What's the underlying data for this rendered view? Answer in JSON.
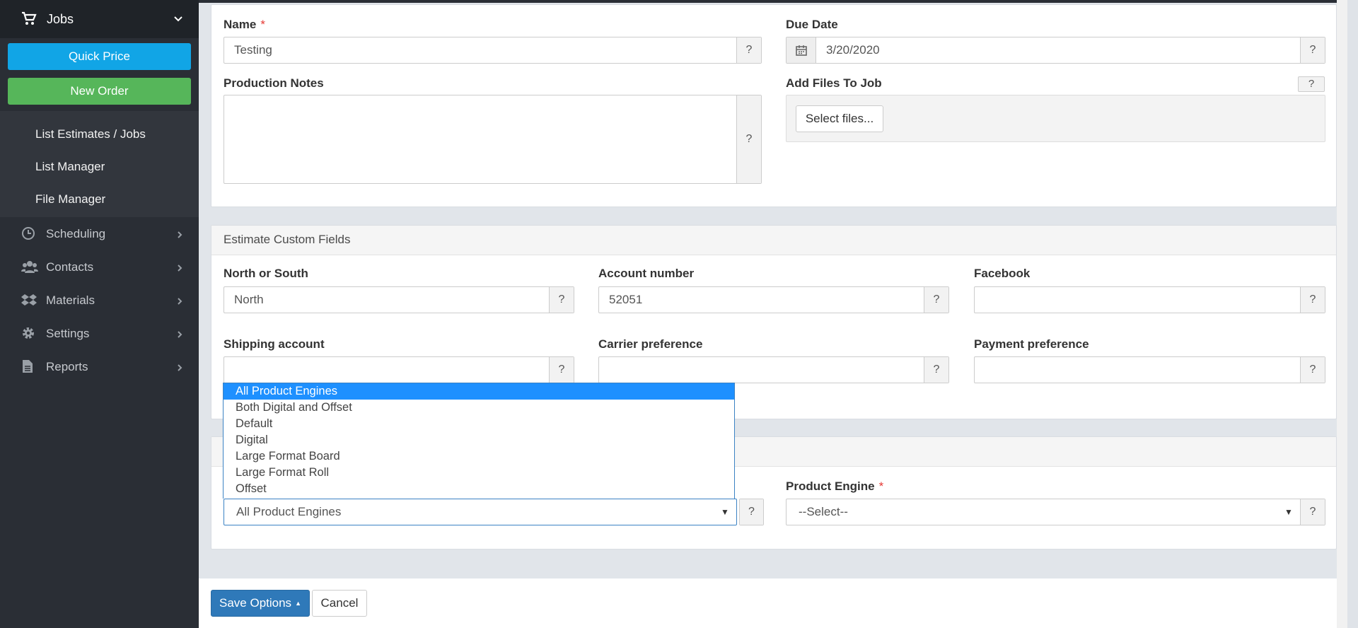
{
  "sidebar": {
    "jobs_label": "Jobs",
    "quick_price": "Quick Price",
    "new_order": "New Order",
    "sub_links": [
      "List Estimates / Jobs",
      "List Manager",
      "File Manager"
    ],
    "items": [
      {
        "label": "Scheduling",
        "icon": "clock-icon"
      },
      {
        "label": "Contacts",
        "icon": "users-icon"
      },
      {
        "label": "Materials",
        "icon": "dropbox-icon"
      },
      {
        "label": "Settings",
        "icon": "gear-icon"
      },
      {
        "label": "Reports",
        "icon": "file-icon"
      }
    ]
  },
  "job": {
    "name_label": "Name",
    "name_value": "Testing",
    "due_label": "Due Date",
    "due_value": "3/20/2020",
    "notes_label": "Production Notes",
    "files_label": "Add Files To Job",
    "select_files": "Select files..."
  },
  "custom": {
    "heading": "Estimate Custom Fields",
    "north_label": "North or South",
    "north_value": "North",
    "account_label": "Account number",
    "account_value": "52051",
    "facebook_label": "Facebook",
    "shipping_label": "Shipping account",
    "carrier_label": "Carrier preference",
    "payment_label": "Payment preference"
  },
  "engine": {
    "filter_value": "All Product Engines",
    "engine_label": "Product Engine",
    "engine_value": "--Select--",
    "options": [
      "All Product Engines",
      "Both Digital and Offset",
      "Default",
      "Digital",
      "Large Format Board",
      "Large Format Roll",
      "Offset"
    ]
  },
  "help": "?",
  "required_mark": "*",
  "footer": {
    "save": "Save Options",
    "cancel": "Cancel"
  }
}
